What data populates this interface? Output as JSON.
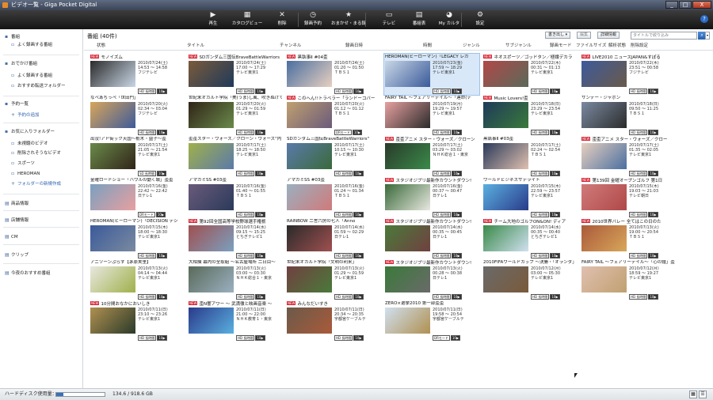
{
  "window": {
    "title": "ビデオ一覧 - Giga Pocket Digital",
    "buttons": [
      "_",
      "□",
      "X"
    ],
    "help": "?"
  },
  "toolbar": {
    "items": [
      {
        "label": "再生",
        "icon": "play-icon",
        "glyph": "▶"
      },
      {
        "label": "カタログビュー",
        "icon": "catalog-icon",
        "glyph": "▦"
      },
      {
        "label": "削除",
        "icon": "delete-icon",
        "glyph": "✕"
      },
      {
        "label": "録画予約",
        "icon": "timer-icon",
        "glyph": "◷"
      },
      {
        "label": "おまかせ・まる録",
        "icon": "star-icon",
        "glyph": "★"
      },
      {
        "label": "テレビ",
        "icon": "tv-icon",
        "glyph": "▭"
      },
      {
        "label": "番組表",
        "icon": "epg-icon",
        "glyph": "▤"
      },
      {
        "label": "My カルタ",
        "icon": "person-icon",
        "glyph": "◕"
      },
      {
        "label": "設定",
        "icon": "settings-icon",
        "glyph": "⚙"
      }
    ]
  },
  "sidebar": {
    "sections": [
      {
        "label": "番組",
        "items": [
          {
            "label": "よく録画する番組"
          }
        ]
      },
      {
        "label": "おでかけ番組",
        "items": [
          {
            "label": "よく録画する番組"
          },
          {
            "label": "おすすめ転送フォルダー"
          }
        ]
      },
      {
        "label": "予約一覧",
        "items": [
          {
            "label": "予約の追加"
          }
        ]
      },
      {
        "label": "お気に入りフォルダー",
        "items": [
          {
            "label": "未視聴のビデオ"
          },
          {
            "label": "削除されそうなビデオ"
          },
          {
            "label": "スポーツ"
          },
          {
            "label": "HEROMAN"
          },
          {
            "label": "フォルダーの新規作成"
          }
        ]
      },
      {
        "label": "商品情報",
        "items": []
      },
      {
        "label": "店舗情報",
        "items": []
      },
      {
        "label": "CM",
        "items": []
      },
      {
        "label": "クリップ",
        "items": []
      },
      {
        "label": "今夜のおすすめ番組",
        "items": []
      }
    ]
  },
  "main": {
    "header": "番組 (40件)",
    "controls": {
      "sort": "書き出し",
      "edit": "編集",
      "detail": "詳細情報",
      "filter_placeholder": "タイトルで絞り込み"
    },
    "columns": [
      "状態",
      "タイトル",
      "チャンネル",
      "録画日時",
      "時間",
      "ジャンル",
      "サブジャンル",
      "録画モード",
      "ファイルサイズ",
      "解析状態",
      "削除設定"
    ]
  },
  "cards": [
    {
      "title": "モノイズム",
      "new": true,
      "date": "2010/07/24(土)",
      "time": "14:53 ～ 14:58",
      "channel": "フジテレビ",
      "mode": "HD 長時間"
    },
    {
      "title": "SDガンダム三国伝BraveBattleWarriors",
      "new": true,
      "date": "2010/07/24(土)",
      "time": "17:00 ～ 17:29",
      "channel": "テレビ東京1",
      "mode": "HD 長時間"
    },
    {
      "title": "黒執事Ⅱ #04歪",
      "new": true,
      "date": "2010/07/24(土)",
      "time": "01:20 ～ 01:50",
      "channel": "ＴＢＳ１",
      "mode": "HD 長時間"
    },
    {
      "title": "HEROMAN(ヒーローマン)「LEGACY レガ",
      "new": false,
      "date": "2010/07/23(金)",
      "time": "17:59 ～ 18:29",
      "channel": "テレビ東京1",
      "mode": "HD 長時間"
    },
    {
      "title": "ネオスポーツ／ゴッドタン／極嬢デカラ",
      "new": true,
      "date": "2010/07/22(木)",
      "time": "00:31 ～ 01:13",
      "channel": "テレビ東京1",
      "mode": "HD 長時間"
    },
    {
      "title": "LIVE2010 ニュースJAPAN&すぽる",
      "new": true,
      "date": "2010/07/22(木)",
      "time": "23:51 ～ 00:58",
      "channel": "フジテレビ",
      "mode": "HD 長時間"
    },
    {
      "title": "なべあちっぺ「世田門」",
      "new": false,
      "date": "2010/07/20(火)",
      "time": "02:34 ～ 03:04",
      "channel": "フジテレビ",
      "mode": "HD 長時間"
    },
    {
      "title": "世紀末オカルト学院「美(うま)し風、吹きぬけて」",
      "new": false,
      "date": "2010/07/20(火)",
      "time": "01:29 ～ 01:59",
      "channel": "テレビ東京1",
      "mode": "HD 長時間"
    },
    {
      "title": "このへん!!トラベラー「ランドーコバー",
      "new": true,
      "date": "2010/07/20(火)",
      "time": "01:12 ～ 01:12",
      "channel": "ＴＢＳ１",
      "mode": "DRモード"
    },
    {
      "title": "FAIRY TAIL ～フェアリーテイル～「連命(デ",
      "new": false,
      "date": "2010/07/19(月)",
      "time": "19:29 ～ 19:57",
      "channel": "テレビ東京1",
      "mode": "HD 長時間"
    },
    {
      "title": "Music Lovers!歪",
      "new": true,
      "date": "2010/07/18(日)",
      "time": "23:29 ～ 23:54",
      "channel": "テレビ東京1",
      "mode": "HD 長時間"
    },
    {
      "title": "サンデー・ジャポン",
      "new": false,
      "date": "2010/07/18(日)",
      "time": "09:50 ～ 11:25",
      "channel": "ＴＢＳ１",
      "mode": "HD 長時間"
    },
    {
      "title": "出没!アド街ック天国～栃木・益子～歪",
      "new": false,
      "date": "2010/07/17(土)",
      "time": "21:05 ～ 21:54",
      "channel": "テレビ東京1",
      "mode": "SD 長時間"
    },
    {
      "title": "歪歪スター・ウォーズ／クローン・ウォーズ\"内",
      "new": false,
      "date": "2010/07/17(土)",
      "time": "18:25 ～ 18:50",
      "channel": "テレビ東京1",
      "mode": "HD 長時間"
    },
    {
      "title": "SDガンダム三国伝BraveBattleWarriors\"",
      "new": false,
      "date": "2010/07/17(土)",
      "time": "10:15 ～ 10:30",
      "channel": "テレビ東京1",
      "mode": "HD 長時間"
    },
    {
      "title": "歪歪アニメ スター・ウォーズ／クローン",
      "new": true,
      "date": "2010/07/17(土)",
      "time": "03:29 ～ 03:02",
      "channel": "ＮＨＫ総合１・東京",
      "mode": "HD 長時間"
    },
    {
      "title": "黒執事Ⅱ #03歪",
      "new": false,
      "date": "2010/07/17(土)",
      "time": "02:24 ～ 02:54",
      "channel": "ＴＢＳ１",
      "mode": "HD 長時間"
    },
    {
      "title": "歪歪アニメ スター・ウォーズ／クロー",
      "new": true,
      "date": "2010/07/17(土)",
      "time": "01:35 ～ 02:05",
      "channel": "テレビ東京1",
      "mode": "HD 長時間"
    },
    {
      "title": "金曜ロードショー「ハウルの動く城」歪歪",
      "new": false,
      "date": "2010/07/16(金)",
      "time": "22:42 ～ 22:42",
      "channel": "日テレ1",
      "mode": "DRモード"
    },
    {
      "title": "アマガミSS #03歪",
      "new": false,
      "date": "2010/07/16(金)",
      "time": "01:40 ～ 01:55",
      "channel": "ＴＢＳ１",
      "mode": "HD 長時間"
    },
    {
      "title": "アマガミSS #03歪",
      "new": false,
      "date": "2010/07/16(金)",
      "time": "01:24 ～ 01:34",
      "channel": "ＴＢＳ１",
      "mode": "HD 長時間"
    },
    {
      "title": "スタジオジブリ最新作カウントダウン!",
      "new": true,
      "date": "2010/07/16(金)",
      "time": "00:37 ～ 00:47",
      "channel": "日テレ1",
      "mode": "HD 長時間"
    },
    {
      "title": "ワールドビジネスサテライト",
      "new": false,
      "date": "2010/07/15(木)",
      "time": "22:59 ～ 23:57",
      "channel": "テレビ東京1",
      "mode": "HD 長時間"
    },
    {
      "title": "第139回 金曜オープンゴルフ 第1日",
      "new": true,
      "date": "2010/07/15(木)",
      "time": "19:03 ～ 21:03",
      "channel": "テレビ朝日",
      "mode": "HD 長時間"
    },
    {
      "title": "HEROMAN(ヒーローマン)「DECISION デシ",
      "new": false,
      "date": "2010/07/15(木)",
      "time": "18:00 ～ 18:30",
      "channel": "テレビ東京1",
      "mode": "HD 長時間"
    },
    {
      "title": "第92回全国高等学校野球選手権栃",
      "new": true,
      "date": "2010/07/14(水)",
      "time": "09:15 ～ 15:25",
      "channel": "とちぎテレビ1",
      "mode": "HD 長時間"
    },
    {
      "title": "RAINBOW 二舎六房の七人「Anno",
      "new": false,
      "date": "2010/07/14(水)",
      "time": "01:59 ～ 02:29",
      "channel": "日テレ1",
      "mode": "HD 長時間"
    },
    {
      "title": "スタジオジブリ最新作カウントダウン!",
      "new": true,
      "date": "2010/07/14(水)",
      "time": "00:35 ～ 00:45",
      "channel": "日テレ1",
      "mode": "HD 長時間"
    },
    {
      "title": "チーム大地のゴルフON&ON! ディア",
      "new": true,
      "date": "2010/07/14(水)",
      "time": "00:35 ～ 00:40",
      "channel": "とちぎテレビ1",
      "mode": "HD 長時間"
    },
    {
      "title": "2010世界バレー 全てはこの日のた",
      "new": true,
      "date": "2010/07/13(火)",
      "time": "19:00 ～ 20:54",
      "channel": "ＴＢＳ１",
      "mode": "HD 長時間"
    },
    {
      "title": "アニソーンぷらす【茅原実里】",
      "new": false,
      "date": "2010/07/13(火)",
      "time": "04:14 ～ 04:44",
      "channel": "テレビ東京1",
      "mode": "HD 長時間"
    },
    {
      "title": "大相撲 幕内の全取組 ～名古屋場所 二日目～",
      "new": false,
      "date": "2010/07/13(火)",
      "time": "03:00 ～ 03:30",
      "channel": "ＮＨＫ総合１・東京",
      "mode": "HD 長時間"
    },
    {
      "title": "世紀末オカルト学院「文明の利来」",
      "new": false,
      "date": "2010/07/13(火)",
      "time": "01:29 ～ 01:59",
      "channel": "テレビ東京1",
      "mode": "HD 長時間"
    },
    {
      "title": "スタジオジブリ最新作カウントダウン!",
      "new": true,
      "date": "2010/07/13(火)",
      "time": "00:28 ～ 00:38",
      "channel": "日テレ1",
      "mode": "HD 長時間"
    },
    {
      "title": "2010FIFAワールドカップ ～決勝・「オランダ」",
      "new": false,
      "date": "2010/07/12(月)",
      "time": "03:00 ～ 05:30",
      "channel": "テレビ東京1",
      "mode": "HD 長時間"
    },
    {
      "title": "FAIRY TAIL ～フェアリーテイル～「心の鐘」歪",
      "new": false,
      "date": "2010/07/12(月)",
      "time": "18:59 ～ 19:27",
      "channel": "テレビ東京1",
      "mode": "HD 長時間"
    },
    {
      "title": "10分間おなかにおいしき",
      "new": true,
      "date": "2010/07/11(日)",
      "time": "23:10 ～ 23:26",
      "channel": "テレビ東京1",
      "mode": "HD 長時間"
    },
    {
      "title": "歪N響アワー ～ 武満徹と映画音楽 ～",
      "new": true,
      "date": "2010/07/11(日)",
      "time": "21:00 ～ 22:00",
      "channel": "ＮＨＫ教育１・東京",
      "mode": "HD 長時間"
    },
    {
      "title": "みんなだいすき",
      "new": true,
      "date": "2010/07/11(日)",
      "time": "20:34 ～ 20:35",
      "channel": "宇都宮ケーブルテ",
      "mode": "HD 長時間"
    },
    {
      "title": "ZERO×選挙2010 第一部歪歪",
      "new": false,
      "date": "2010/07/11(日)",
      "time": "19:58 ～ 20:54",
      "channel": "宇都宮ケーブルテ",
      "mode": "DRモード"
    }
  ],
  "thumb_colors": [
    "#2b2b2b",
    "#7a5a3a",
    "#4a6fa0",
    "#c9d7e6",
    "#b04848",
    "#3d5a9a",
    "#d8a65a",
    "#302418",
    "#c0a070",
    "#e8a0a0",
    "#1e3a5a",
    "#7a8aa0",
    "#6a8a4a",
    "#a0b04a",
    "#5a7aaa",
    "#2a3a2a",
    "#2a3a5a",
    "#e8d0c0",
    "#7aa0c0",
    "#6a5a7a",
    "#9ab0c0",
    "#3a6a3a",
    "#5ab0e0",
    "#d07a7a",
    "#3a5a9a",
    "#a05050",
    "#2a2a2a",
    "#4a7a3a",
    "#3a8a4a",
    "#aa5a3a",
    "#e8e8e0",
    "#5a6a5a",
    "#704040",
    "#3a7a3a",
    "#6a6a6a",
    "#e0c0b0",
    "#b09050",
    "#2a3a8a",
    "#6a5a4a",
    "#d0e0f0"
  ],
  "selected_index": 3,
  "status": {
    "label": "ハードディスク使用量：",
    "usage": "134.6 / 918.6 GB",
    "used_fraction": 0.147
  }
}
